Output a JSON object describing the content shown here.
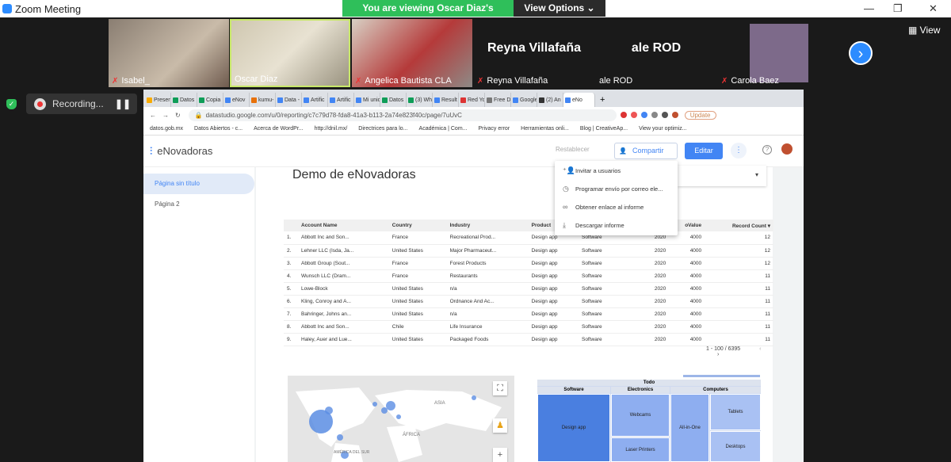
{
  "window": {
    "title": "Zoom Meeting",
    "viewing_banner": "You are viewing Oscar Diaz's screen",
    "view_options": "View Options ⌄"
  },
  "participants": [
    {
      "name": "Isabel_",
      "muted": true
    },
    {
      "name": "Oscar Diaz",
      "muted": false
    },
    {
      "name": "Angelica Bautista CLA",
      "muted": true
    },
    {
      "name": "Reyna Villafaña",
      "muted": true,
      "display": "Reyna Villafaña"
    },
    {
      "name": "ale ROD",
      "muted": false,
      "display": "ale ROD"
    },
    {
      "name": "Carola Baez",
      "muted": true
    }
  ],
  "gallery": {
    "view_label": "View"
  },
  "recording": {
    "label": "Recording..."
  },
  "browser": {
    "tabs": [
      "Presen",
      "Datos",
      "Copia",
      "eNov",
      "kumu-",
      "Data -",
      "Artific",
      "Artific",
      "Mi unic",
      "Datos",
      "(3) Wh",
      "Result",
      "Red Yo",
      "Free D",
      "Google",
      "(2) An",
      "eNo"
    ],
    "url": "datastudio.google.com/u/0/reporting/c7c79d78-fda8-41a3-b113-2a74e823f40c/page/7uUvC",
    "update_label": "Update",
    "bookmarks": [
      "datos.gob.mx",
      "Datos Abiertos - c...",
      "Acerca de WordPr...",
      "http://dnil.mx/",
      "Directrices para lo...",
      "Académica | Com...",
      "Privacy error",
      "Herramientas onli...",
      "Blog | CreativeAp...",
      "View your optimiz..."
    ]
  },
  "app": {
    "name": "eNovadoras",
    "reset": "Restablecer",
    "share": "Compartir",
    "edit": "Editar",
    "pages": [
      "Página sin título",
      "Página 2"
    ],
    "report_title": "Demo de eNovadoras"
  },
  "share_menu": [
    "Invitar a usuarios",
    "Programar envío por correo ele...",
    "Obtener enlace al informe",
    "Descargar informe"
  ],
  "table": {
    "headers": [
      "Account Name",
      "Country",
      "Industry",
      "Product",
      "Product categ",
      "",
      "oValue",
      "Record Count ▾"
    ],
    "rows": [
      [
        "1.",
        "Abbott Inc and Son...",
        "France",
        "Recreational Prod...",
        "Design app",
        "Software",
        "2020",
        "4000",
        "12"
      ],
      [
        "2.",
        "Lehner LLC (Isda, Ja...",
        "United States",
        "Major Pharmaceut...",
        "Design app",
        "Software",
        "2020",
        "4000",
        "12"
      ],
      [
        "3.",
        "Abbott Group (Sout...",
        "France",
        "Forest Products",
        "Design app",
        "Software",
        "2020",
        "4000",
        "12"
      ],
      [
        "4.",
        "Wunsch LLC (Dram...",
        "France",
        "Restaurants",
        "Design app",
        "Software",
        "2020",
        "4000",
        "11"
      ],
      [
        "5.",
        "Lowe-Block",
        "United States",
        "n/a",
        "Design app",
        "Software",
        "2020",
        "4000",
        "11"
      ],
      [
        "6.",
        "Kling, Conroy and A...",
        "United States",
        "Ordnance And Ac...",
        "Design app",
        "Software",
        "2020",
        "4000",
        "11"
      ],
      [
        "7.",
        "Bahringer, Johns an...",
        "United States",
        "n/a",
        "Design app",
        "Software",
        "2020",
        "4000",
        "11"
      ],
      [
        "8.",
        "Abbott Inc and Son...",
        "Chile",
        "Life Insurance",
        "Design app",
        "Software",
        "2020",
        "4000",
        "11"
      ],
      [
        "9.",
        "Haley, Auer and Lue...",
        "United States",
        "Packaged Foods",
        "Design app",
        "Software",
        "2020",
        "4000",
        "11"
      ]
    ],
    "pagination": "1 - 100 / 6395"
  },
  "treemap": {
    "root": "Todo",
    "groups": [
      "Software",
      "Electronics",
      "Computers"
    ],
    "cells": [
      "Design app",
      "Webcams",
      "Laser Printers",
      "All-in-One",
      "Tablets",
      "Desktops"
    ]
  },
  "map_labels": [
    "ASIA",
    "ÁFRICA",
    "AMÉRICA DEL SUR"
  ]
}
